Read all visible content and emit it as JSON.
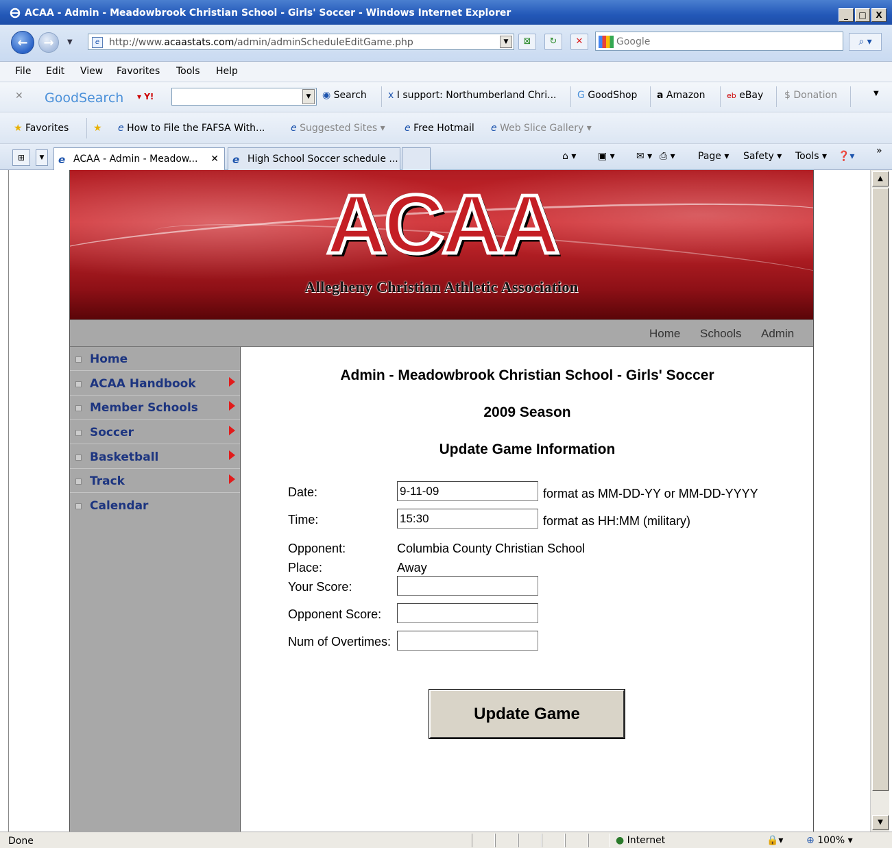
{
  "window": {
    "title": "ACAA - Admin - Meadowbrook Christian School - Girls' Soccer - Windows Internet Explorer",
    "minimize": "_",
    "maximize": "□",
    "close": "X"
  },
  "address": {
    "url_prefix": "http://www.",
    "url_domain": "acaastats.com",
    "url_path": "/admin/adminScheduleEditGame.php",
    "search_placeholder": "Google"
  },
  "menu": [
    "File",
    "Edit",
    "View",
    "Favorites",
    "Tools",
    "Help"
  ],
  "goodsearch": {
    "logo": "GoodSearch",
    "search_label": "Search",
    "support": "I support: Northumberland Chri...",
    "goodshop": "GoodShop",
    "amazon": "Amazon",
    "ebay": "eBay",
    "donation": "Donation"
  },
  "favorites": {
    "label": "Favorites",
    "items": [
      "How to File the FAFSA With...",
      "Suggested Sites ▾",
      "Free Hotmail",
      "Web Slice Gallery ▾"
    ]
  },
  "tabs": [
    {
      "title": "ACAA - Admin - Meadow...",
      "close": "✕"
    },
    {
      "title": "High School Soccer schedule ..."
    }
  ],
  "commandbar": {
    "page": "Page ▾",
    "safety": "Safety ▾",
    "tools": "Tools ▾"
  },
  "site": {
    "logo": "ACAA",
    "subtitle": "Allegheny Christian Athletic Association",
    "topnav": [
      "Home",
      "Schools",
      "Admin"
    ],
    "leftnav": [
      {
        "label": "Home",
        "submenu": false
      },
      {
        "label": "ACAA Handbook",
        "submenu": true
      },
      {
        "label": "Member Schools",
        "submenu": true
      },
      {
        "label": "Soccer",
        "submenu": true
      },
      {
        "label": "Basketball",
        "submenu": true
      },
      {
        "label": "Track",
        "submenu": true
      },
      {
        "label": "Calendar",
        "submenu": false
      }
    ]
  },
  "form": {
    "heading": "Admin - Meadowbrook Christian School - Girls' Soccer",
    "season": "2009 Season",
    "subheading": "Update Game Information",
    "date_label": "Date:",
    "date_value": "9-11-09",
    "date_hint": "format as MM-DD-YY or MM-DD-YYYY",
    "time_label": "Time:",
    "time_value": "15:30",
    "time_hint": "format as HH:MM (military)",
    "opponent_label": "Opponent:",
    "opponent_value": "Columbia County Christian School",
    "place_label": "Place:",
    "place_value": "Away",
    "your_score_label": "Your Score:",
    "opponent_score_label": "Opponent Score:",
    "overtimes_label": "Num of Overtimes:",
    "submit": "Update Game"
  },
  "status": {
    "left": "Done",
    "zone": "Internet",
    "zoom": "100%"
  }
}
